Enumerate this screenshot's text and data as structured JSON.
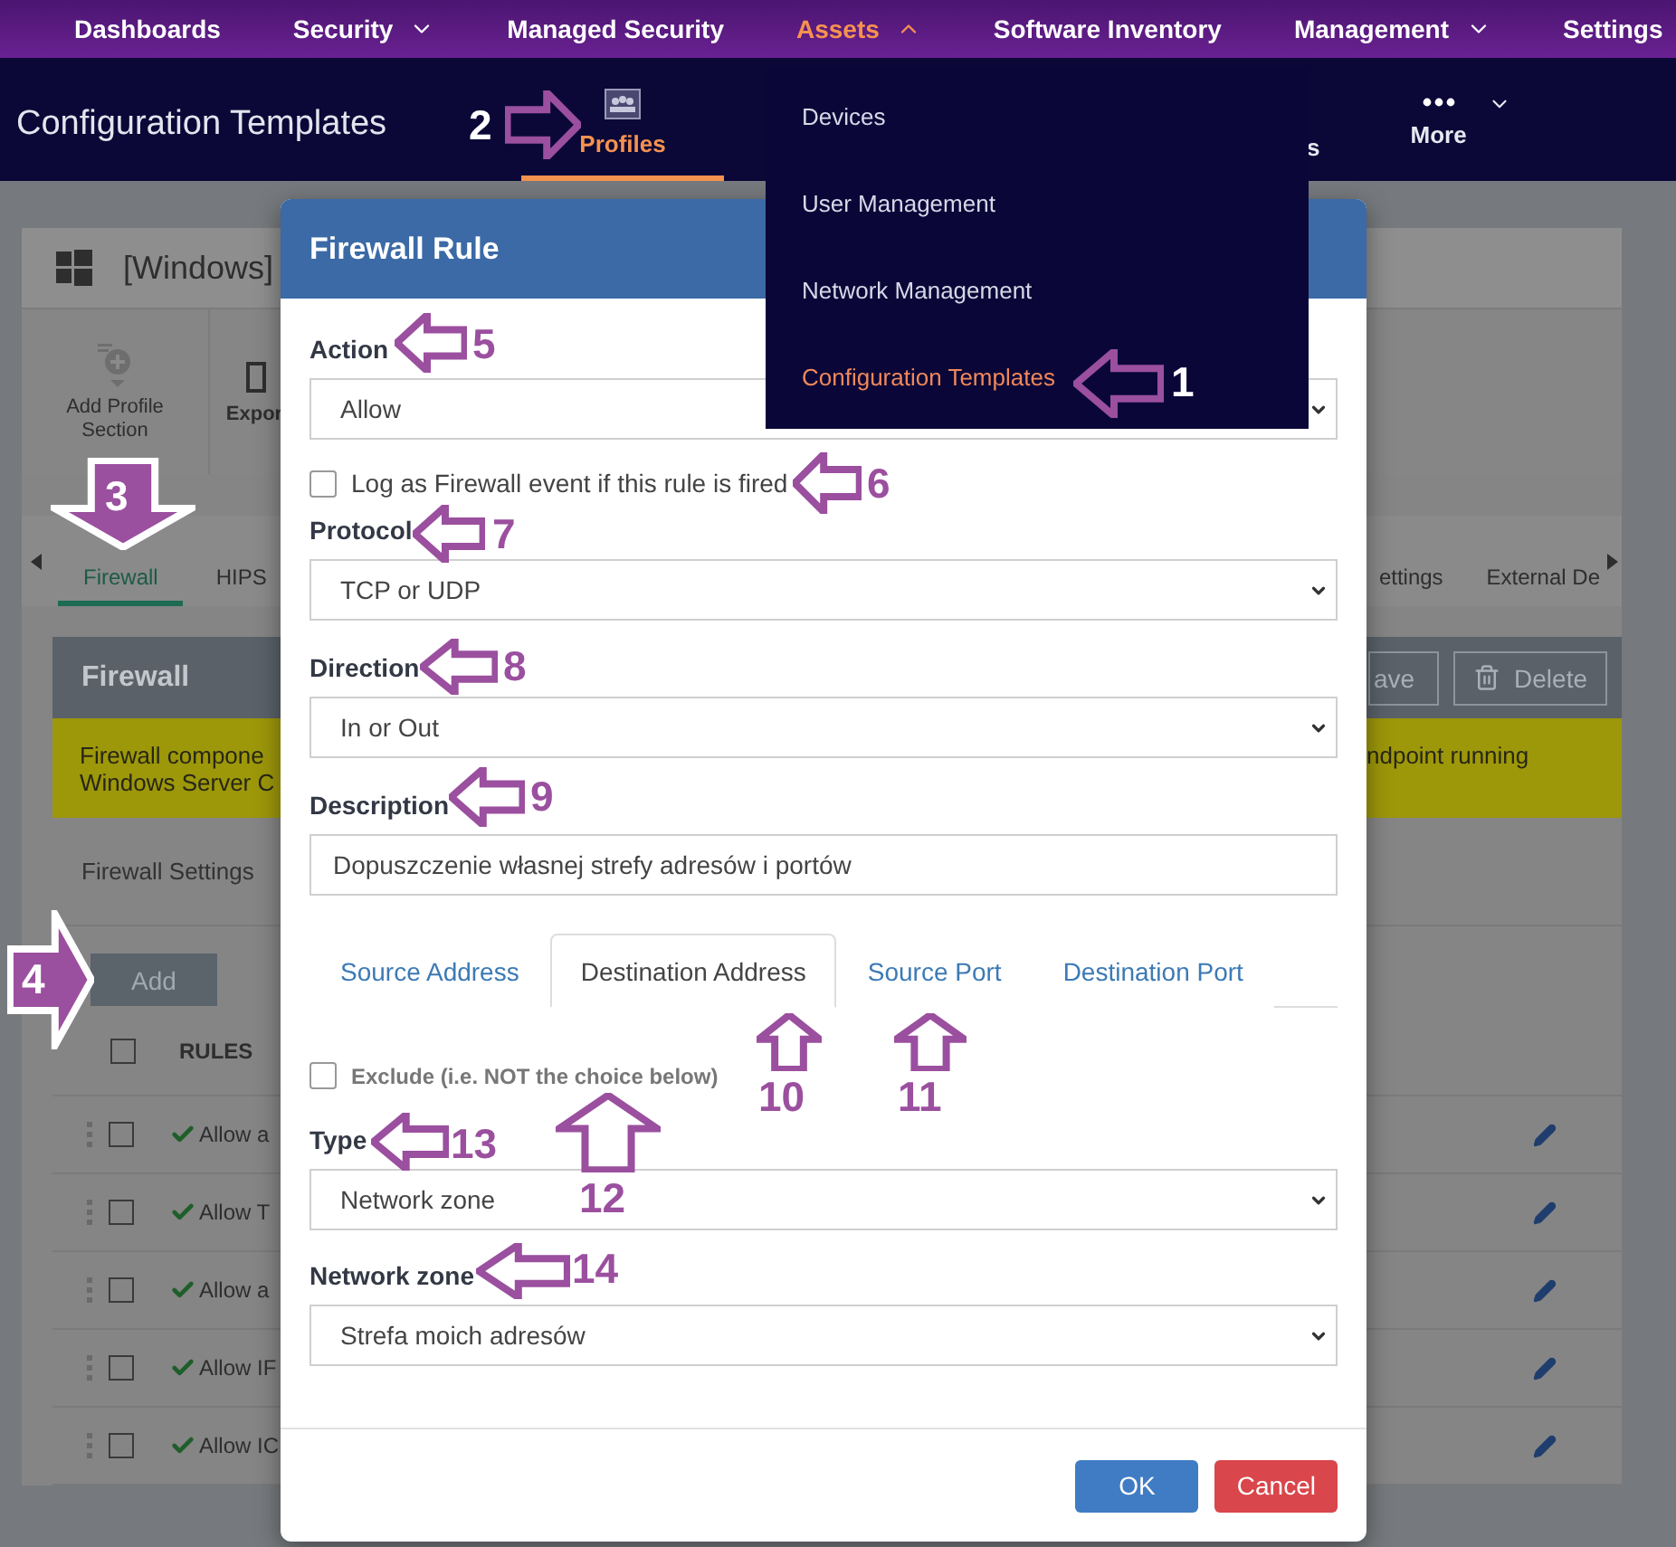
{
  "top_nav": [
    {
      "label": "Dashboards",
      "selected": false
    },
    {
      "label": "Security",
      "selected": false
    },
    {
      "label": "Managed Security",
      "selected": false
    },
    {
      "label": "Assets",
      "selected": true
    },
    {
      "label": "Software Inventory",
      "selected": false
    },
    {
      "label": "Management",
      "selected": false
    },
    {
      "label": "Settings",
      "selected": false
    }
  ],
  "page_header": {
    "title": "Configuration Templates",
    "tabs": [
      {
        "label": "Profiles",
        "selected": true
      },
      {
        "label": "s",
        "selected": false
      }
    ],
    "more": "More"
  },
  "assets_menu": {
    "items": [
      {
        "label": "Devices",
        "selected": false
      },
      {
        "label": "User Management",
        "selected": false
      },
      {
        "label": "Network Management",
        "selected": false
      },
      {
        "label": "Configuration Templates",
        "selected": true
      }
    ]
  },
  "profile": {
    "title": "[Windows]",
    "toolbar": [
      "Add Profile Section",
      "Expor"
    ],
    "tabs": [
      {
        "label": "Firewall",
        "selected": true
      },
      {
        "label": "HIPS",
        "selected": false
      },
      {
        "label": "ettings",
        "selected": false
      },
      {
        "label": "External De",
        "selected": false
      }
    ]
  },
  "firewall_panel": {
    "title": "Firewall",
    "buttons": [
      {
        "label": "ave",
        "kind": "save"
      },
      {
        "label": "Delete",
        "kind": "delete"
      }
    ],
    "warning_left": [
      "Firewall compone",
      "Windows Server C"
    ],
    "warning_right": "ndpoint running",
    "settings_label": "Firewall Settings",
    "add_button": "Add",
    "rules_header": {
      "label": "RULES",
      "checked": false
    },
    "rules": [
      {
        "name": "Allow a",
        "checked": false,
        "enabled": true
      },
      {
        "name": "Allow T",
        "checked": false,
        "enabled": true
      },
      {
        "name": "Allow a",
        "checked": false,
        "enabled": true
      },
      {
        "name": "Allow IF",
        "checked": false,
        "enabled": true
      },
      {
        "name": "Allow IC",
        "checked": false,
        "enabled": true
      }
    ]
  },
  "dialog": {
    "title": "Firewall Rule",
    "action": {
      "label": "Action",
      "value": "Allow"
    },
    "log_event": {
      "label": "Log as Firewall event if this rule is fired",
      "checked": false
    },
    "protocol": {
      "label": "Protocol",
      "value": "TCP or UDP"
    },
    "direction": {
      "label": "Direction",
      "value": "In or Out"
    },
    "description": {
      "label": "Description",
      "value": "Dopuszczenie własnej strefy adresów i portów"
    },
    "address_tabs": [
      {
        "label": "Source Address",
        "selected": false
      },
      {
        "label": "Destination Address",
        "selected": true
      },
      {
        "label": "Source Port",
        "selected": false
      },
      {
        "label": "Destination Port",
        "selected": false
      }
    ],
    "exclude": {
      "label": "Exclude (i.e. NOT the choice below)",
      "checked": false
    },
    "type": {
      "label": "Type",
      "value": "Network zone"
    },
    "network_zone": {
      "label": "Network zone",
      "value": "Strefa moich adresów"
    },
    "buttons": [
      {
        "label": "OK",
        "kind": "primary"
      },
      {
        "label": "Cancel",
        "kind": "danger"
      }
    ]
  },
  "annotations": [
    {
      "label": "1"
    },
    {
      "label": "2"
    },
    {
      "label": "3"
    },
    {
      "label": "4"
    },
    {
      "label": "5"
    },
    {
      "label": "6"
    },
    {
      "label": "7"
    },
    {
      "label": "8"
    },
    {
      "label": "9"
    },
    {
      "label": "10"
    },
    {
      "label": "11"
    },
    {
      "label": "12"
    },
    {
      "label": "13"
    },
    {
      "label": "14"
    }
  ]
}
